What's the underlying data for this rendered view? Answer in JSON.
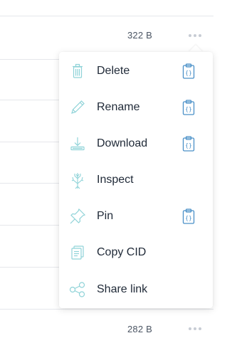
{
  "rows": [
    {
      "size": "322 B"
    },
    {
      "size": "282 B"
    }
  ],
  "context_menu": {
    "items": [
      {
        "label": "Delete",
        "icon": "trash-icon",
        "clipboard": true
      },
      {
        "label": "Rename",
        "icon": "pencil-icon",
        "clipboard": true
      },
      {
        "label": "Download",
        "icon": "download-icon",
        "clipboard": true
      },
      {
        "label": "Inspect",
        "icon": "tree-icon",
        "clipboard": false
      },
      {
        "label": "Pin",
        "icon": "pin-icon",
        "clipboard": true
      },
      {
        "label": "Copy CID",
        "icon": "copy-icon",
        "clipboard": false
      },
      {
        "label": "Share link",
        "icon": "share-icon",
        "clipboard": false
      }
    ]
  },
  "colors": {
    "icon_teal": "#8fd3d8",
    "clipboard_blue": "#4a90c8",
    "text": "#1f2937",
    "muted": "#4b5563"
  }
}
